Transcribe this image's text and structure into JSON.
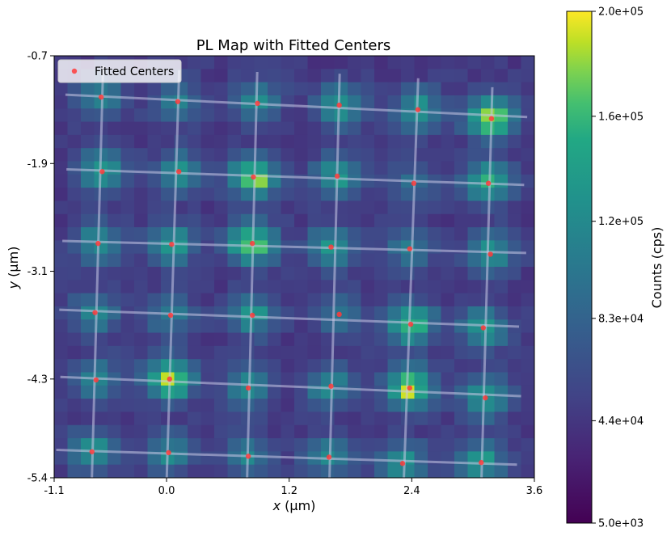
{
  "chart_data": {
    "type": "heatmap",
    "title": "PL Map with Fitted Centers",
    "xlabel_var": "x",
    "xlabel_unit": " (µm)",
    "ylabel_var": "y",
    "ylabel_unit": " (µm)",
    "xlim": [
      -1.1,
      3.6
    ],
    "ylim": [
      -5.4,
      -0.7
    ],
    "xticks": [
      -1.1,
      0.0,
      1.2,
      2.4,
      3.6
    ],
    "xtick_labels": [
      "-1.1",
      "0.0",
      "1.2",
      "2.4",
      "3.6"
    ],
    "yticks": [
      -0.7,
      -1.9,
      -3.1,
      -4.3,
      -5.4
    ],
    "ytick_labels": [
      "-0.7",
      "-1.9",
      "-3.1",
      "-4.3",
      "-5.4"
    ],
    "colorbar": {
      "label": "Counts (cps)",
      "colormap": "viridis",
      "vmin": 5000,
      "vmax": 200000,
      "ticks": [
        5000,
        44000,
        83000,
        120000,
        160000,
        200000
      ],
      "tick_labels": [
        "5.0e+03",
        "4.4e+04",
        "8.3e+04",
        "1.2e+05",
        "1.6e+05",
        "2.0e+05"
      ]
    },
    "background_counts": 45000,
    "spot_sigma_um": 0.16,
    "legend": {
      "label": "Fitted Centers",
      "position": "top-left",
      "marker_color": "#ff3b3b"
    },
    "grid_line_color": "#c8c8e6",
    "fitted_centers": [
      {
        "x": -0.64,
        "y": -1.16,
        "peak": 115000
      },
      {
        "x": 0.11,
        "y": -1.21,
        "peak": 115000
      },
      {
        "x": 0.89,
        "y": -1.23,
        "peak": 120000
      },
      {
        "x": 1.69,
        "y": -1.25,
        "peak": 135000
      },
      {
        "x": 2.46,
        "y": -1.3,
        "peak": 130000
      },
      {
        "x": 3.18,
        "y": -1.4,
        "peak": 195000
      },
      {
        "x": -0.63,
        "y": -1.99,
        "peak": 140000
      },
      {
        "x": 0.12,
        "y": -1.99,
        "peak": 125000
      },
      {
        "x": 0.85,
        "y": -2.05,
        "peak": 185000
      },
      {
        "x": 1.67,
        "y": -2.04,
        "peak": 140000
      },
      {
        "x": 2.42,
        "y": -2.12,
        "peak": 100000
      },
      {
        "x": 3.15,
        "y": -2.12,
        "peak": 155000
      },
      {
        "x": -0.67,
        "y": -2.79,
        "peak": 130000
      },
      {
        "x": 0.05,
        "y": -2.8,
        "peak": 140000
      },
      {
        "x": 0.84,
        "y": -2.79,
        "peak": 180000
      },
      {
        "x": 1.61,
        "y": -2.83,
        "peak": 130000
      },
      {
        "x": 2.38,
        "y": -2.85,
        "peak": 105000
      },
      {
        "x": 3.17,
        "y": -2.91,
        "peak": 135000
      },
      {
        "x": -0.7,
        "y": -3.56,
        "peak": 115000
      },
      {
        "x": 0.04,
        "y": -3.59,
        "peak": 105000
      },
      {
        "x": 0.84,
        "y": -3.59,
        "peak": 130000
      },
      {
        "x": 1.69,
        "y": -3.58,
        "peak": 100000
      },
      {
        "x": 2.39,
        "y": -3.69,
        "peak": 170000
      },
      {
        "x": 3.1,
        "y": -3.73,
        "peak": 135000
      },
      {
        "x": -0.69,
        "y": -4.31,
        "peak": 125000
      },
      {
        "x": 0.03,
        "y": -4.3,
        "peak": 185000
      },
      {
        "x": 0.8,
        "y": -4.4,
        "peak": 125000
      },
      {
        "x": 1.61,
        "y": -4.38,
        "peak": 125000
      },
      {
        "x": 2.38,
        "y": -4.4,
        "peak": 190000
      },
      {
        "x": 3.12,
        "y": -4.51,
        "peak": 140000
      },
      {
        "x": -0.73,
        "y": -5.11,
        "peak": 135000
      },
      {
        "x": 0.02,
        "y": -5.12,
        "peak": 120000
      },
      {
        "x": 0.8,
        "y": -5.16,
        "peak": 110000
      },
      {
        "x": 1.59,
        "y": -5.17,
        "peak": 120000
      },
      {
        "x": 2.31,
        "y": -5.24,
        "peak": 135000
      },
      {
        "x": 3.08,
        "y": -5.23,
        "peak": 135000
      }
    ]
  }
}
